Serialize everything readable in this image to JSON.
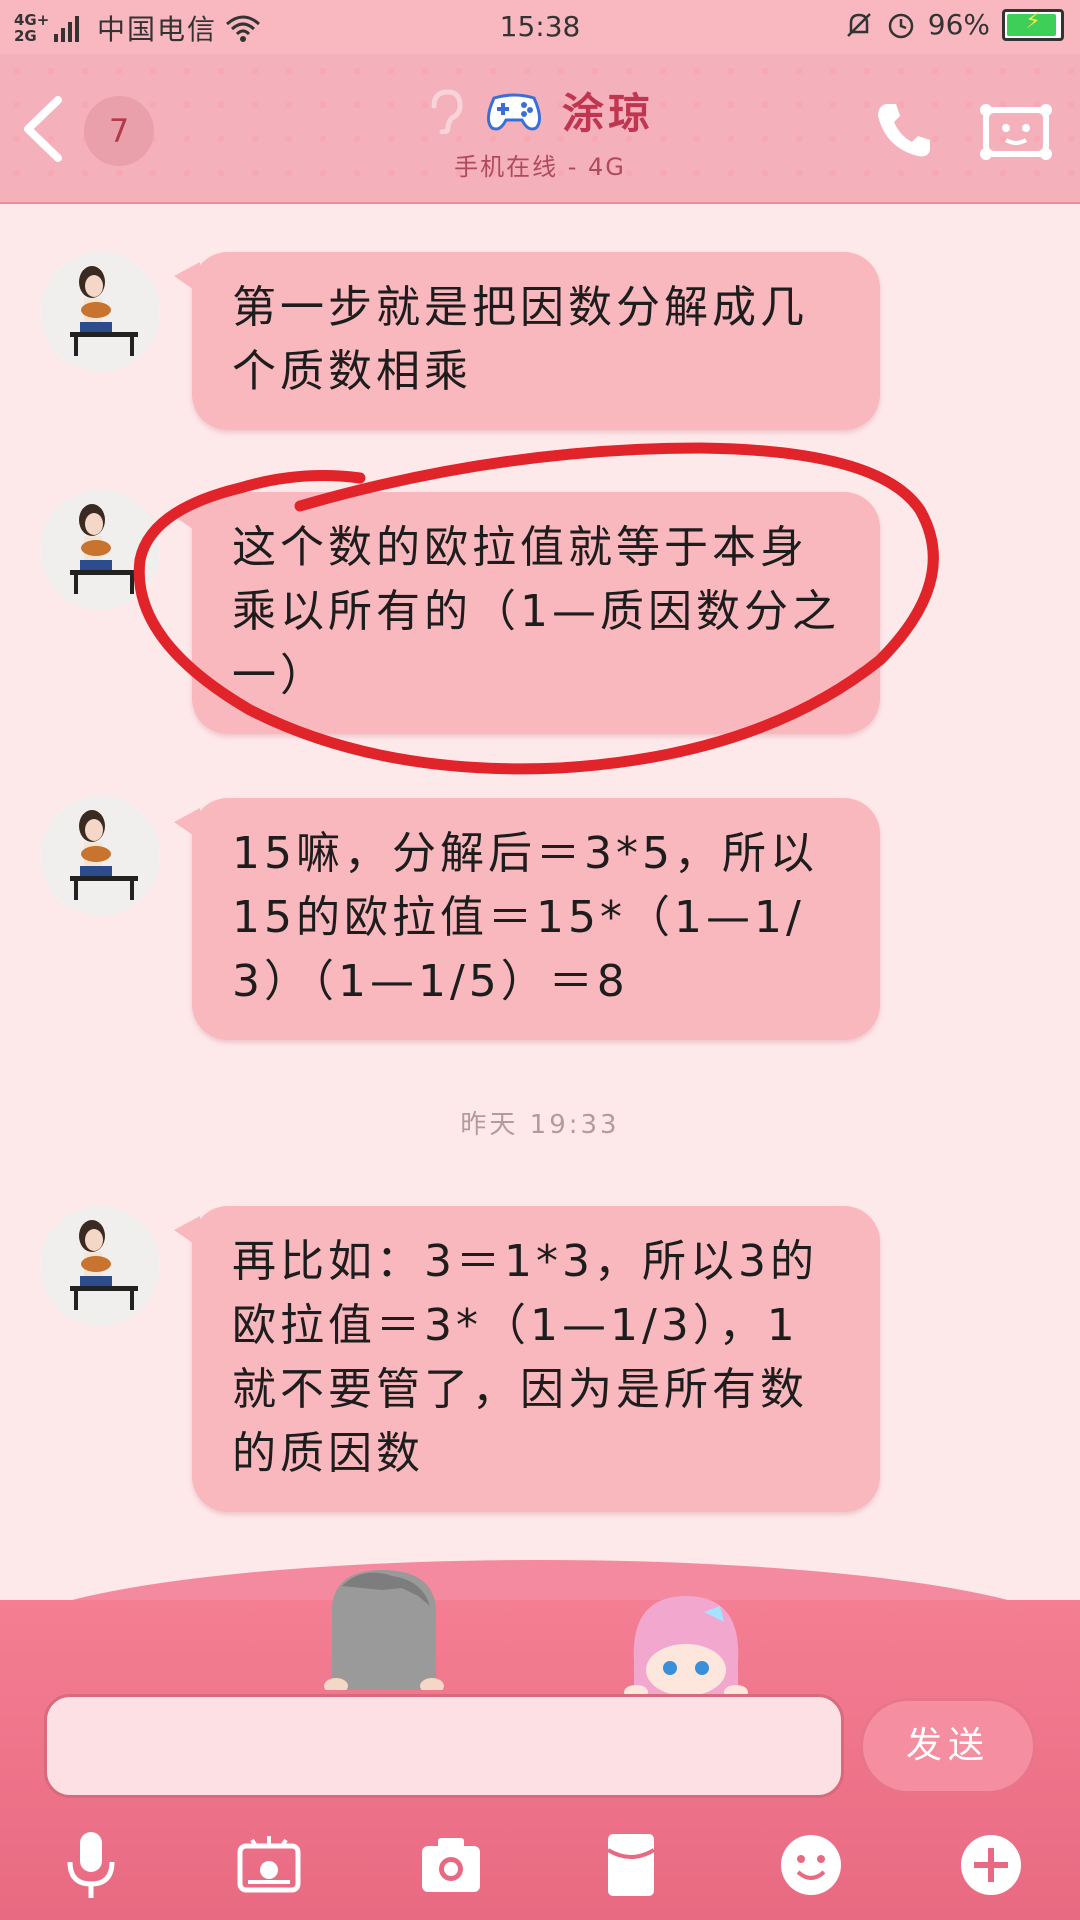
{
  "status_bar": {
    "network": "4G+ 2G",
    "carrier": "中国电信",
    "time": "15:38",
    "battery": "96%"
  },
  "header": {
    "unread_count": "7",
    "contact_name": "涂琼",
    "status": "手机在线 - 4G"
  },
  "messages": [
    {
      "text": "第一步就是把因数分解成几个质数相乘"
    },
    {
      "text": "这个数的欧拉值就等于本身乘以所有的（1—质因数分之一）"
    },
    {
      "text": "15嘛，分解后＝3*5，所以15的欧拉值＝15*（1—1/3）（1—1/5）＝8"
    },
    {
      "text": "再比如：3＝1*3，所以3的欧拉值＝3*（1—1/3），1就不要管了，因为是所有数的质因数"
    }
  ],
  "timestamp": "昨天 19:33",
  "composer": {
    "placeholder": "",
    "send_label": "发送"
  },
  "colors": {
    "accent": "#f48ea0",
    "bubble": "#f9b7be",
    "annotation": "#e0242a"
  }
}
